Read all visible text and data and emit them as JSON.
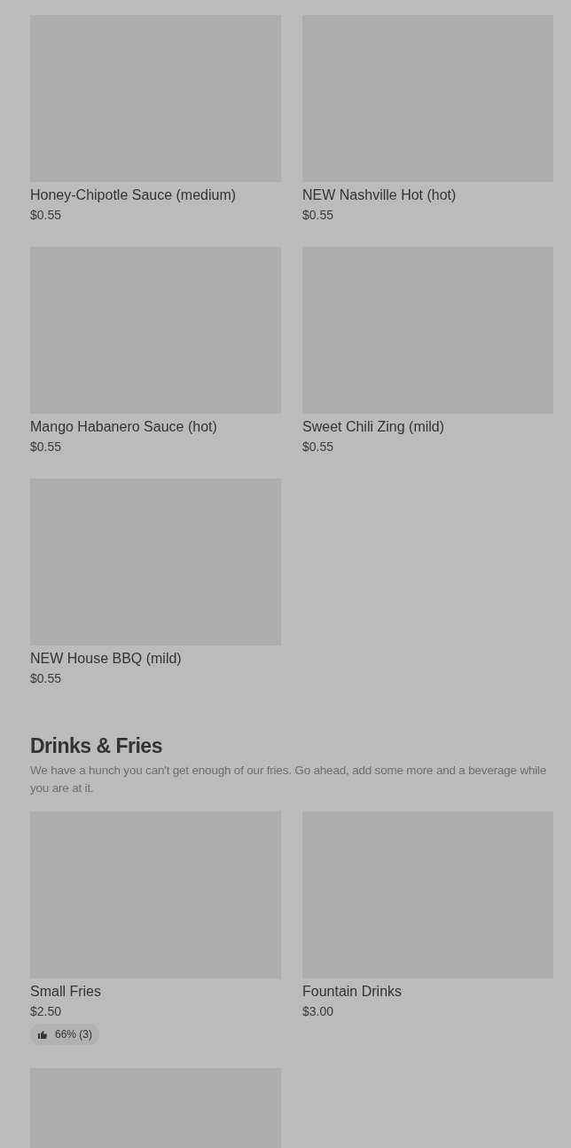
{
  "sections": [
    {
      "items": [
        {
          "kind": "item",
          "name": "Honey-Chipotle Sauce (medium)",
          "price": "$0.55"
        },
        {
          "kind": "item",
          "name": "NEW Nashville Hot (hot)",
          "price": "$0.55"
        },
        {
          "kind": "item",
          "name": "Mango Habanero Sauce (hot)",
          "price": "$0.55"
        },
        {
          "kind": "item",
          "name": "Sweet Chili Zing (mild)",
          "price": "$0.55"
        },
        {
          "kind": "item",
          "name": "NEW House BBQ (mild)",
          "price": "$0.55"
        }
      ]
    },
    {
      "title": "Drinks & Fries",
      "description": "We have a hunch you can't get enough of our fries. Go ahead, add some more and a beverage while you are at it.",
      "items": [
        {
          "kind": "item",
          "name": "Small Fries",
          "price": "$2.50",
          "rating": "66% (3)"
        },
        {
          "kind": "item",
          "name": "Fountain Drinks",
          "price": "$3.00"
        },
        {
          "kind": "image_only"
        }
      ]
    }
  ]
}
